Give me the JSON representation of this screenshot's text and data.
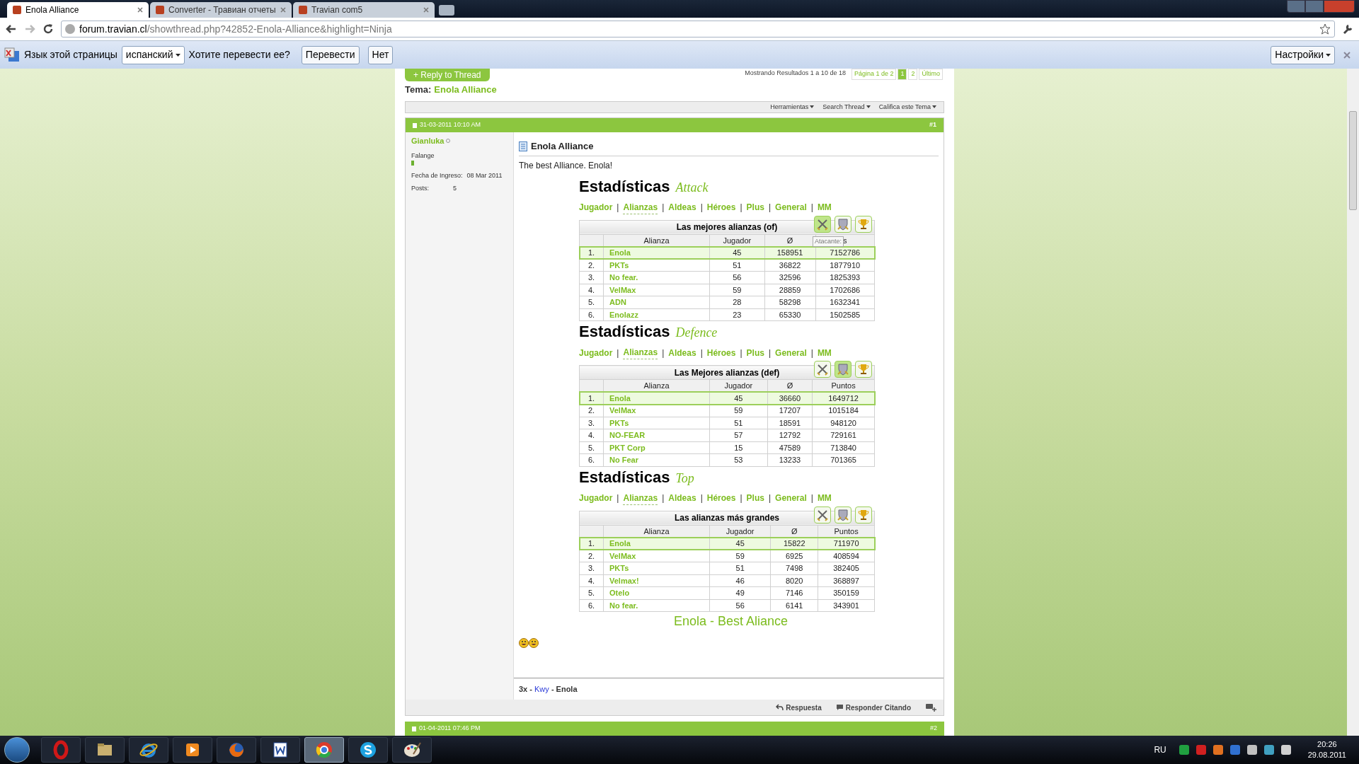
{
  "browser": {
    "tabs": [
      {
        "title": "Enola Alliance",
        "selected": true
      },
      {
        "title": "Converter - Травиан отчеты",
        "selected": false
      },
      {
        "title": "Travian com5",
        "selected": false
      }
    ],
    "address": {
      "host": "forum.travian.cl",
      "path": "/showthread.php?42852-Enola-Alliance&highlight=Ninja"
    },
    "translate_bar": {
      "label": "Язык этой страницы",
      "language": "испанский",
      "question": "Хотите перевести ее?",
      "translate": "Перевести",
      "no": "Нет",
      "settings": "Настройки"
    }
  },
  "thread": {
    "reply_button": "+ Reply to Thread",
    "results": "Mostrando Resultados 1 a 10 de 18",
    "pagination": [
      {
        "label": "Página 1 de 2",
        "selected": false
      },
      {
        "label": "1",
        "selected": true
      },
      {
        "label": "2",
        "selected": false
      },
      {
        "label": "Último",
        "selected": false
      }
    ],
    "topic_label": "Tema:",
    "topic": "Enola Alliance",
    "tools": [
      "Herramientas",
      "Search Thread",
      "Califica este Tema"
    ]
  },
  "post": {
    "date": "31-03-2011 10:10 AM",
    "number": "#1",
    "author": "Gianluka",
    "rank": "Falange",
    "join_label": "Fecha de Ingreso:",
    "join_date": "08 Mar 2011",
    "posts_label": "Posts:",
    "posts": "5",
    "title": "Enola Alliance",
    "text": "The best Alliance. Enola!",
    "sections": [
      {
        "title": "Estadísticas",
        "subtitle": "Attack",
        "separator": "|",
        "nav": [
          {
            "label": "Jugador",
            "selected": false
          },
          {
            "label": "Alianzas",
            "selected": true
          },
          {
            "label": "Aldeas",
            "selected": false
          },
          {
            "label": "Héroes",
            "selected": false
          },
          {
            "label": "Plus",
            "selected": false
          },
          {
            "label": "General",
            "selected": false
          },
          {
            "label": "MM",
            "selected": false
          }
        ],
        "table_title": "Las mejores alianzas (of)",
        "mode_buttons": [
          {
            "kind": "attack",
            "selected": true
          },
          {
            "kind": "defence",
            "selected": false
          },
          {
            "kind": "top",
            "selected": false
          }
        ],
        "tooltip": "Atacante:",
        "columns": [
          "Alianza",
          "Jugador",
          "Ø",
          "s"
        ],
        "rows": [
          {
            "rank": "1.",
            "name": "Enola",
            "players": "45",
            "average": "158951",
            "points": "7152786",
            "selected": true
          },
          {
            "rank": "2.",
            "name": "PKTs",
            "players": "51",
            "average": "36822",
            "points": "1877910",
            "selected": false
          },
          {
            "rank": "3.",
            "name": "No fear.",
            "players": "56",
            "average": "32596",
            "points": "1825393",
            "selected": false
          },
          {
            "rank": "4.",
            "name": "VelMax",
            "players": "59",
            "average": "28859",
            "points": "1702686",
            "selected": false
          },
          {
            "rank": "5.",
            "name": "ADN",
            "players": "28",
            "average": "58298",
            "points": "1632341",
            "selected": false
          },
          {
            "rank": "6.",
            "name": "Enolazz",
            "players": "23",
            "average": "65330",
            "points": "1502585",
            "selected": false
          }
        ]
      },
      {
        "title": "Estadísticas",
        "subtitle": "Defence",
        "separator": "|",
        "nav": [
          {
            "label": "Jugador",
            "selected": false
          },
          {
            "label": "Alianzas",
            "selected": true
          },
          {
            "label": "Aldeas",
            "selected": false
          },
          {
            "label": "Héroes",
            "selected": false
          },
          {
            "label": "Plus",
            "selected": false
          },
          {
            "label": "General",
            "selected": false
          },
          {
            "label": "MM",
            "selected": false
          }
        ],
        "table_title": "Las Mejores alianzas (def)",
        "mode_buttons": [
          {
            "kind": "attack",
            "selected": false
          },
          {
            "kind": "defence",
            "selected": true
          },
          {
            "kind": "top",
            "selected": false
          }
        ],
        "columns": [
          "Alianza",
          "Jugador",
          "Ø",
          "Puntos"
        ],
        "rows": [
          {
            "rank": "1.",
            "name": "Enola",
            "players": "45",
            "average": "36660",
            "points": "1649712",
            "selected": true
          },
          {
            "rank": "2.",
            "name": "VelMax",
            "players": "59",
            "average": "17207",
            "points": "1015184",
            "selected": false
          },
          {
            "rank": "3.",
            "name": "PKTs",
            "players": "51",
            "average": "18591",
            "points": "948120",
            "selected": false
          },
          {
            "rank": "4.",
            "name": "NO-FEAR",
            "players": "57",
            "average": "12792",
            "points": "729161",
            "selected": false
          },
          {
            "rank": "5.",
            "name": "PKT Corp",
            "players": "15",
            "average": "47589",
            "points": "713840",
            "selected": false
          },
          {
            "rank": "6.",
            "name": "No Fear",
            "players": "53",
            "average": "13233",
            "points": "701365",
            "selected": false
          }
        ]
      },
      {
        "title": "Estadísticas",
        "subtitle": "Top",
        "separator": "|",
        "nav": [
          {
            "label": "Jugador",
            "selected": false
          },
          {
            "label": "Alianzas",
            "selected": true
          },
          {
            "label": "Aldeas",
            "selected": false
          },
          {
            "label": "Héroes",
            "selected": false
          },
          {
            "label": "Plus",
            "selected": false
          },
          {
            "label": "General",
            "selected": false
          },
          {
            "label": "MM",
            "selected": false
          }
        ],
        "table_title": "Las alianzas más grandes",
        "mode_buttons": [
          {
            "kind": "attack",
            "selected": false
          },
          {
            "kind": "defence",
            "selected": false
          },
          {
            "kind": "top",
            "selected": false
          }
        ],
        "columns": [
          "Alianza",
          "Jugador",
          "Ø",
          "Puntos"
        ],
        "rows": [
          {
            "rank": "1.",
            "name": "Enola",
            "players": "45",
            "average": "15822",
            "points": "711970",
            "selected": true
          },
          {
            "rank": "2.",
            "name": "VelMax",
            "players": "59",
            "average": "6925",
            "points": "408594",
            "selected": false
          },
          {
            "rank": "3.",
            "name": "PKTs",
            "players": "51",
            "average": "7498",
            "points": "382405",
            "selected": false
          },
          {
            "rank": "4.",
            "name": "Velmax!",
            "players": "46",
            "average": "8020",
            "points": "368897",
            "selected": false
          },
          {
            "rank": "5.",
            "name": "Otelo",
            "players": "49",
            "average": "7146",
            "points": "350159",
            "selected": false
          },
          {
            "rank": "6.",
            "name": "No fear.",
            "players": "56",
            "average": "6141",
            "points": "343901",
            "selected": false
          }
        ]
      }
    ],
    "banner": "Enola - Best Aliance",
    "signature": {
      "prefix": "3x -",
      "link": "Kwy",
      "suffix": "- Enola"
    },
    "actions": [
      "Respuesta",
      "Responder Citando"
    ]
  },
  "next_post": {
    "date": "01-04-2011 07:46 PM",
    "number": "#2"
  },
  "taskbar": {
    "apps": [
      {
        "kind": "opera",
        "selected": false
      },
      {
        "kind": "folder",
        "selected": false
      },
      {
        "kind": "ie",
        "selected": false
      },
      {
        "kind": "media",
        "selected": false
      },
      {
        "kind": "firefox",
        "selected": false
      },
      {
        "kind": "word",
        "selected": false
      },
      {
        "kind": "chrome",
        "selected": true
      },
      {
        "kind": "skype",
        "selected": false
      },
      {
        "kind": "paint",
        "selected": false
      }
    ],
    "language": "RU",
    "time": "20:26",
    "date": "29.08.2011"
  }
}
